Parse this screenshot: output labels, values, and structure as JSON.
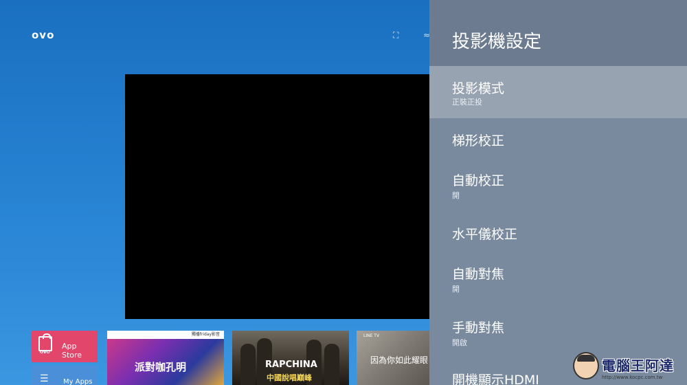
{
  "launcher": {
    "logo": "ovo",
    "app_store": {
      "label": "App Store",
      "bag_text": "OVO"
    },
    "my_apps": {
      "label": "My Apps"
    },
    "posters": [
      {
        "header": "獨播friday影音",
        "title": "派對咖孔明"
      },
      {
        "title": "RAPCHINA",
        "subtitle": "中國說唱巔峰"
      },
      {
        "tag": "LINE TV",
        "title": "因為你如此耀眼"
      }
    ]
  },
  "settings_panel": {
    "title": "投影機設定",
    "items": [
      {
        "label": "投影模式",
        "value": "正裝正投",
        "active": true
      },
      {
        "label": "梯形校正",
        "value": ""
      },
      {
        "label": "自動校正",
        "value": "開"
      },
      {
        "label": "水平儀校正",
        "value": ""
      },
      {
        "label": "自動對焦",
        "value": "開"
      },
      {
        "label": "手動對焦",
        "value": "開啟"
      },
      {
        "label": "開機顯示HDMI",
        "value": ""
      }
    ]
  },
  "watermark": {
    "text": "電腦王阿達",
    "url": "http://www.kocpc.com.tw"
  }
}
